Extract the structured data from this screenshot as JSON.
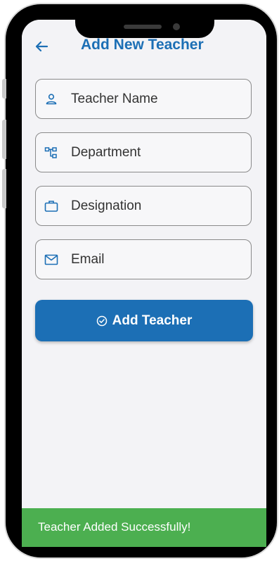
{
  "header": {
    "title": "Add New Teacher",
    "back_icon": "arrow-left-icon",
    "title_color": "#1c6fb5"
  },
  "form": {
    "fields": [
      {
        "placeholder": "Teacher Name",
        "icon": "person-icon"
      },
      {
        "placeholder": "Department",
        "icon": "hierarchy-icon"
      },
      {
        "placeholder": "Designation",
        "icon": "briefcase-icon"
      },
      {
        "placeholder": "Email",
        "icon": "mail-icon"
      }
    ],
    "submit_label": "Add Teacher",
    "submit_icon": "check-circle-icon",
    "accent_color": "#1c6fb5"
  },
  "snackbar": {
    "message": "Teacher Added Successfully!",
    "color": "#4caf50"
  }
}
